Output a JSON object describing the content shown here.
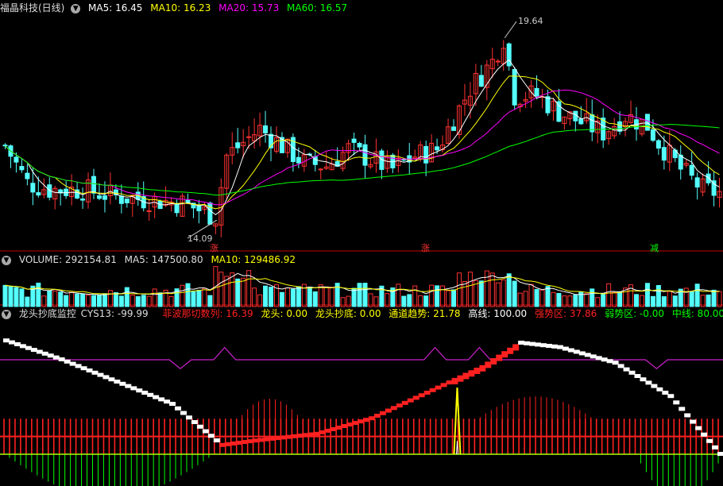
{
  "colors": {
    "bg": "#000000",
    "up": "#ff3232",
    "down": "#54ffff",
    "ma5": "#ffffff",
    "ma10": "#ffff00",
    "ma20": "#ff00ff",
    "ma60": "#00ff00",
    "divider": "#c00000"
  },
  "price_panel": {
    "stock_title": "福晶科技(日线)",
    "ma5_label": "MA5: 16.45",
    "ma10_label": "MA10: 16.23",
    "ma20_label": "MA20: 15.73",
    "ma60_label": "MA60: 16.57",
    "high_label": "19.64",
    "low_label": "14.09",
    "markers": [
      {
        "text": "涨",
        "color": "#ff3232"
      },
      {
        "text": "涨",
        "color": "#ff3232"
      },
      {
        "text": "减",
        "color": "#00ff00"
      }
    ]
  },
  "volume_panel": {
    "volume_label": "VOLUME: 292154.81",
    "ma5_label": "MA5: 147500.80",
    "ma10_label": "MA10: 129486.92"
  },
  "indicator_panel": {
    "name": "龙头抄底监控",
    "cys13_label": "CYS13: -99.99",
    "items": [
      {
        "text": "菲波那切数列: 16.39",
        "color": "#ff2020"
      },
      {
        "text": "龙头: 0.00",
        "color": "#ffff00"
      },
      {
        "text": "龙头抄底: 0.00",
        "color": "#ffff00"
      },
      {
        "text": "通道趋势: 21.78",
        "color": "#ffff00"
      },
      {
        "text": "高线: 100.00",
        "color": "#ffffff"
      },
      {
        "text": "强势区: 37.86",
        "color": "#ff2020"
      },
      {
        "text": "弱势区: -0.00",
        "color": "#00ff00"
      },
      {
        "text": "中线: 80.00",
        "color": "#00ff00"
      }
    ]
  },
  "chart_data": [
    {
      "type": "candlestick",
      "title": "福晶科技(日线)",
      "ylim": [
        13.6,
        20.2
      ],
      "high_marker": 19.64,
      "low_marker": 14.09,
      "ma": {
        "MA5": 16.45,
        "MA10": 16.23,
        "MA20": 15.73,
        "MA60": 16.57
      }
    },
    {
      "type": "bar",
      "title": "VOLUME",
      "values_last": {
        "VOLUME": 292154.81,
        "MA5": 147500.8,
        "MA10": 129486.92
      }
    },
    {
      "type": "line",
      "title": "龙头抄底监控",
      "ylim": [
        -20,
        120
      ],
      "levels": {
        "高线": 100.0,
        "中线": 80.0
      },
      "last": {
        "CYS13": -99.99,
        "菲波那切数列": 16.39,
        "龙头": 0.0,
        "龙头抄底": 0.0,
        "通道趋势": 21.78,
        "强势区": 37.86,
        "弱势区": -0.0
      }
    }
  ]
}
